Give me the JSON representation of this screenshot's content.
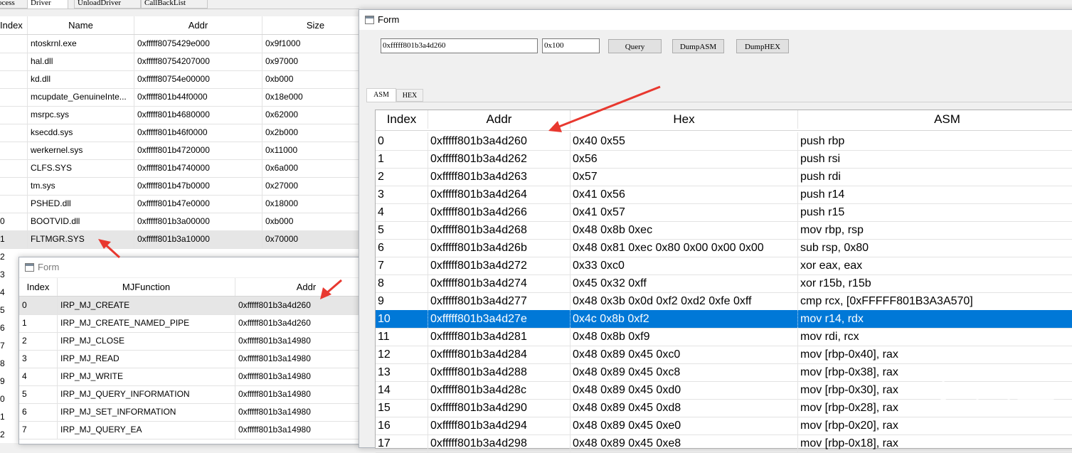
{
  "driver_window": {
    "tabs": [
      "ocess",
      "Driver",
      "UnloadDriver",
      "CallBackList"
    ],
    "columns": [
      "Index",
      "Name",
      "Addr",
      "Size"
    ],
    "rows": [
      {
        "index": "",
        "name": "ntoskrnl.exe",
        "addr": "0xfffff8075429e000",
        "size": "0x9f1000"
      },
      {
        "index": "",
        "name": "hal.dll",
        "addr": "0xfffff80754207000",
        "size": "0x97000"
      },
      {
        "index": "",
        "name": "kd.dll",
        "addr": "0xfffff80754e00000",
        "size": "0xb000"
      },
      {
        "index": "",
        "name": "mcupdate_GenuineInte...",
        "addr": "0xfffff801b44f0000",
        "size": "0x18e000"
      },
      {
        "index": "",
        "name": "msrpc.sys",
        "addr": "0xfffff801b4680000",
        "size": "0x62000"
      },
      {
        "index": "",
        "name": "ksecdd.sys",
        "addr": "0xfffff801b46f0000",
        "size": "0x2b000"
      },
      {
        "index": "",
        "name": "werkernel.sys",
        "addr": "0xfffff801b4720000",
        "size": "0x11000"
      },
      {
        "index": "",
        "name": "CLFS.SYS",
        "addr": "0xfffff801b4740000",
        "size": "0x6a000"
      },
      {
        "index": "",
        "name": "tm.sys",
        "addr": "0xfffff801b47b0000",
        "size": "0x27000"
      },
      {
        "index": "",
        "name": "PSHED.dll",
        "addr": "0xfffff801b47e0000",
        "size": "0x18000"
      },
      {
        "index": "0",
        "name": "BOOTVID.dll",
        "addr": "0xfffff801b3a00000",
        "size": "0xb000"
      },
      {
        "index": "1",
        "name": "FLTMGR.SYS",
        "addr": "0xfffff801b3a10000",
        "size": "0x70000"
      }
    ],
    "left_index_digits": [
      "2",
      "3",
      "4",
      "5",
      "6",
      "7",
      "8",
      "9",
      "0",
      "1",
      "2"
    ]
  },
  "mj_form": {
    "title": "Form",
    "columns": [
      "Index",
      "MJFunction",
      "Addr"
    ],
    "rows": [
      {
        "index": "0",
        "fn": "IRP_MJ_CREATE",
        "addr": "0xfffff801b3a4d260"
      },
      {
        "index": "1",
        "fn": "IRP_MJ_CREATE_NAMED_PIPE",
        "addr": "0xfffff801b3a4d260"
      },
      {
        "index": "2",
        "fn": "IRP_MJ_CLOSE",
        "addr": "0xfffff801b3a14980"
      },
      {
        "index": "3",
        "fn": "IRP_MJ_READ",
        "addr": "0xfffff801b3a14980"
      },
      {
        "index": "4",
        "fn": "IRP_MJ_WRITE",
        "addr": "0xfffff801b3a14980"
      },
      {
        "index": "5",
        "fn": "IRP_MJ_QUERY_INFORMATION",
        "addr": "0xfffff801b3a14980"
      },
      {
        "index": "6",
        "fn": "IRP_MJ_SET_INFORMATION",
        "addr": "0xfffff801b3a14980"
      },
      {
        "index": "7",
        "fn": "IRP_MJ_QUERY_EA",
        "addr": "0xfffff801b3a14980"
      }
    ]
  },
  "dump_form": {
    "title": "Form",
    "addr_input": "0xfffff801b3a4d260",
    "size_input": "0x100",
    "buttons": {
      "query": "Query",
      "dump_asm": "DumpASM",
      "dump_hex": "DumpHEX"
    },
    "tabs": [
      "ASM",
      "HEX"
    ],
    "columns": [
      "Index",
      "Addr",
      "Hex",
      "ASM"
    ],
    "rows": [
      {
        "index": "0",
        "addr": "0xfffff801b3a4d260",
        "hex": "0x40 0x55",
        "asm": "push rbp"
      },
      {
        "index": "1",
        "addr": "0xfffff801b3a4d262",
        "hex": "0x56",
        "asm": "push rsi"
      },
      {
        "index": "2",
        "addr": "0xfffff801b3a4d263",
        "hex": "0x57",
        "asm": "push rdi"
      },
      {
        "index": "3",
        "addr": "0xfffff801b3a4d264",
        "hex": "0x41 0x56",
        "asm": "push r14"
      },
      {
        "index": "4",
        "addr": "0xfffff801b3a4d266",
        "hex": "0x41 0x57",
        "asm": "push r15"
      },
      {
        "index": "5",
        "addr": "0xfffff801b3a4d268",
        "hex": "0x48 0x8b 0xec",
        "asm": "mov rbp, rsp"
      },
      {
        "index": "6",
        "addr": "0xfffff801b3a4d26b",
        "hex": "0x48 0x81 0xec 0x80 0x00 0x00 0x00",
        "asm": "sub rsp, 0x80"
      },
      {
        "index": "7",
        "addr": "0xfffff801b3a4d272",
        "hex": "0x33 0xc0",
        "asm": "xor eax, eax"
      },
      {
        "index": "8",
        "addr": "0xfffff801b3a4d274",
        "hex": "0x45 0x32 0xff",
        "asm": "xor r15b, r15b"
      },
      {
        "index": "9",
        "addr": "0xfffff801b3a4d277",
        "hex": "0x48 0x3b 0x0d 0xf2 0xd2 0xfe 0xff",
        "asm": "cmp rcx, [0xFFFFF801B3A3A570]"
      },
      {
        "index": "10",
        "addr": "0xfffff801b3a4d27e",
        "hex": "0x4c 0x8b 0xf2",
        "asm": "mov r14, rdx"
      },
      {
        "index": "11",
        "addr": "0xfffff801b3a4d281",
        "hex": "0x48 0x8b 0xf9",
        "asm": "mov rdi, rcx"
      },
      {
        "index": "12",
        "addr": "0xfffff801b3a4d284",
        "hex": "0x48 0x89 0x45 0xc0",
        "asm": "mov [rbp-0x40], rax"
      },
      {
        "index": "13",
        "addr": "0xfffff801b3a4d288",
        "hex": "0x48 0x89 0x45 0xc8",
        "asm": "mov [rbp-0x38], rax"
      },
      {
        "index": "14",
        "addr": "0xfffff801b3a4d28c",
        "hex": "0x48 0x89 0x45 0xd0",
        "asm": "mov [rbp-0x30], rax"
      },
      {
        "index": "15",
        "addr": "0xfffff801b3a4d290",
        "hex": "0x48 0x89 0x45 0xd8",
        "asm": "mov [rbp-0x28], rax"
      },
      {
        "index": "16",
        "addr": "0xfffff801b3a4d294",
        "hex": "0x48 0x89 0x45 0xe0",
        "asm": "mov [rbp-0x20], rax"
      },
      {
        "index": "17",
        "addr": "0xfffff801b3a4d298",
        "hex": "0x48 0x89 0x45 0xe8",
        "asm": "mov [rbp-0x18], rax"
      }
    ],
    "selected_index": "10"
  },
  "colors": {
    "selection": "#0078d7",
    "arrow": "#e8382f",
    "row_highlight": "#e6e6e6"
  },
  "watermark": {
    "icon": "snowflake-icon"
  }
}
